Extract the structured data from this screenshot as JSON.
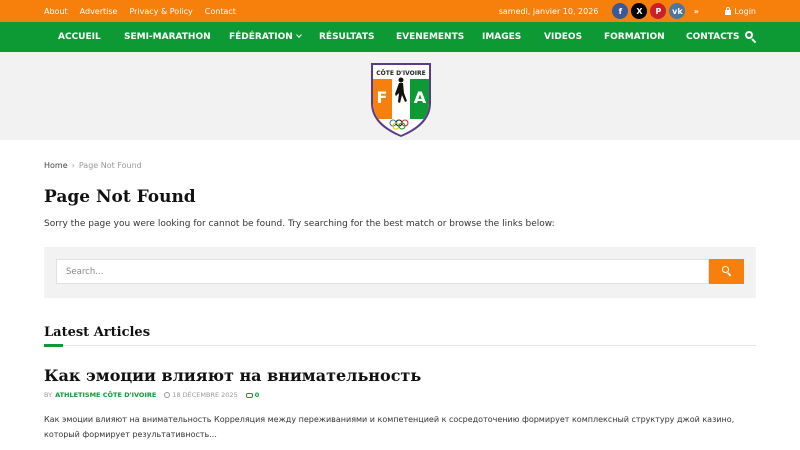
{
  "topbar": {
    "links": [
      "About",
      "Advertise",
      "Privacy & Policy",
      "Contact"
    ],
    "date": "samedi, janvier 10, 2026",
    "social": [
      {
        "icon": "facebook-icon",
        "glyph": "f"
      },
      {
        "icon": "x-icon",
        "glyph": "X"
      },
      {
        "icon": "pinterest-icon",
        "glyph": "P"
      },
      {
        "icon": "vk-icon",
        "glyph": "vk"
      },
      {
        "icon": "rss-icon",
        "glyph": "»"
      }
    ],
    "login": "Login"
  },
  "nav": {
    "items": [
      "ACCUEIL",
      "SEMI-MARATHON",
      "FÉDÉRATION",
      "RÉSULTATS",
      "EVENEMENTS",
      "IMAGES",
      "VIDEOS",
      "FORMATION",
      "CONTACTS"
    ]
  },
  "logo": {
    "text": "CÔTE D'IVOIRE",
    "letters_left": "F",
    "letters_right": "A"
  },
  "breadcrumb": {
    "home": "Home",
    "current": "Page Not Found"
  },
  "page": {
    "title": "Page Not Found",
    "message": "Sorry the page you were looking for cannot be found. Try searching for the best match or browse the links below:"
  },
  "search": {
    "placeholder": "Search..."
  },
  "latest": {
    "heading": "Latest Articles",
    "article": {
      "title": "Как эмоции влияют на внимательность",
      "by": "BY",
      "author": "ATHLETISME CÔTE D'IVOIRE",
      "date": "18 DÉCEMBRE 2025",
      "comments": "0",
      "excerpt": "Как эмоции влияют на внимательность Корреляция между переживаниями и компетенцией к сосредоточению формирует комплексный структуру джой казино, который формирует результативность..."
    }
  },
  "colors": {
    "topbar": "#f77f0c",
    "nav": "#0d9a35",
    "accent": "#f77f0c"
  }
}
